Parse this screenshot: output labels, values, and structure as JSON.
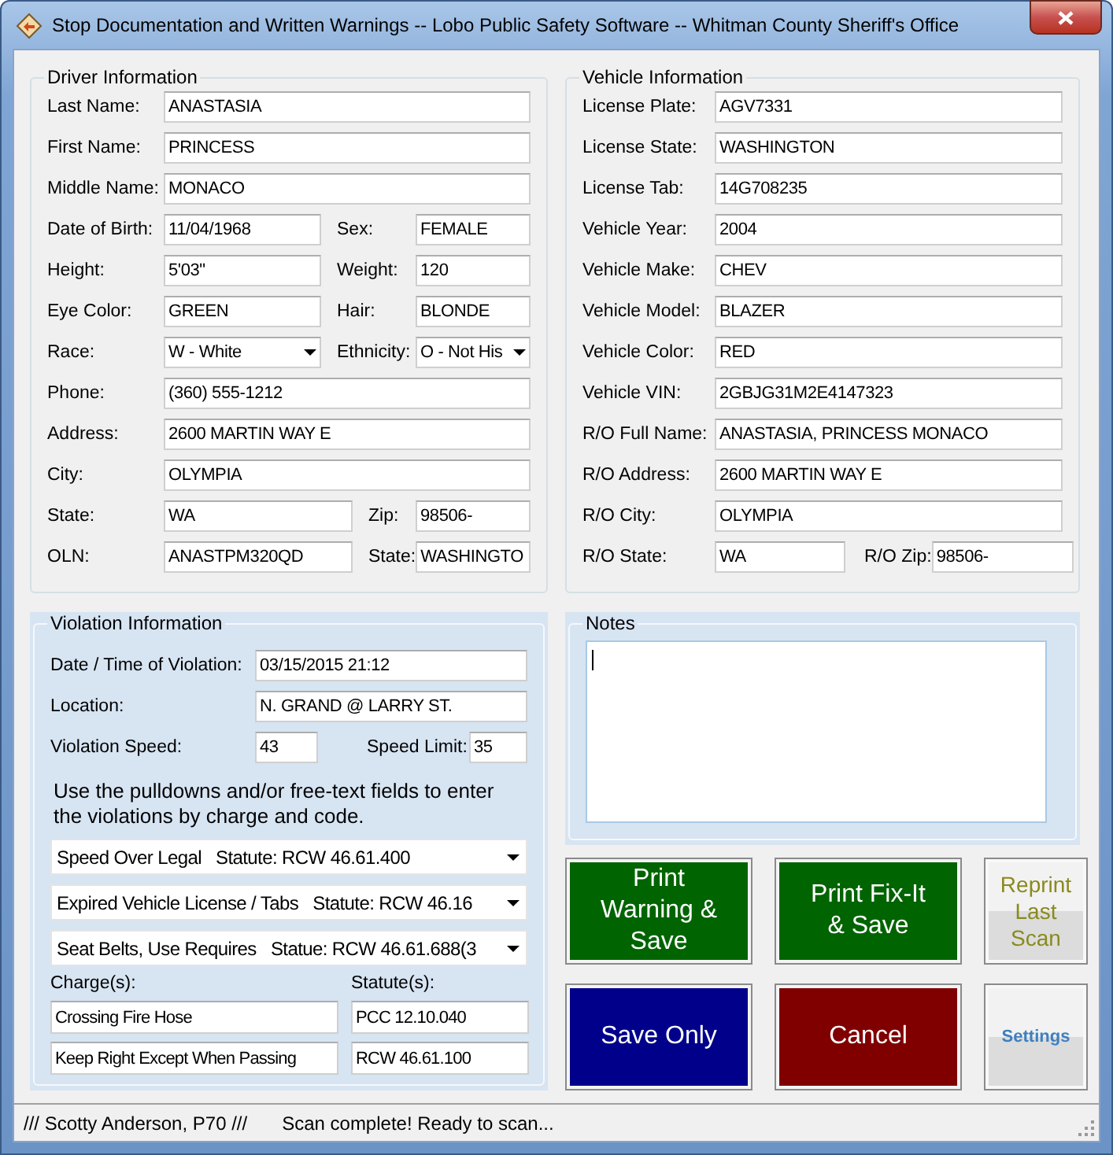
{
  "window": {
    "title": "Stop Documentation and Written Warnings -- Lobo Public Safety Software -- Whitman County Sheriff's Office"
  },
  "driver": {
    "title": "Driver Information",
    "rows": [
      {
        "kind": "single",
        "fields": [
          {
            "label": "Last Name:",
            "value": "ANASTASIA",
            "kind": "text"
          }
        ]
      },
      {
        "kind": "single",
        "fields": [
          {
            "label": "First Name:",
            "value": "PRINCESS",
            "kind": "text"
          }
        ]
      },
      {
        "kind": "single",
        "fields": [
          {
            "label": "Middle Name:",
            "value": "MONACO",
            "kind": "text"
          }
        ]
      },
      {
        "kind": "pair",
        "fields": [
          {
            "label": "Date of Birth:",
            "value": "11/04/1968",
            "kind": "text"
          },
          {
            "label": "Sex:",
            "value": "FEMALE",
            "kind": "text"
          }
        ]
      },
      {
        "kind": "pair",
        "fields": [
          {
            "label": "Height:",
            "value": "5'03\"",
            "kind": "text"
          },
          {
            "label": "Weight:",
            "value": "120",
            "kind": "text"
          }
        ]
      },
      {
        "kind": "pair",
        "fields": [
          {
            "label": "Eye Color:",
            "value": "GREEN",
            "kind": "text"
          },
          {
            "label": "Hair:",
            "value": "BLONDE",
            "kind": "text"
          }
        ]
      },
      {
        "kind": "pair",
        "fields": [
          {
            "label": "Race:",
            "value": "W - White",
            "kind": "dropdown"
          },
          {
            "label": "Ethnicity:",
            "value": "O - Not His",
            "kind": "dropdown"
          }
        ]
      },
      {
        "kind": "single",
        "fields": [
          {
            "label": "Phone:",
            "value": "(360) 555-1212",
            "kind": "text"
          }
        ]
      },
      {
        "kind": "single",
        "fields": [
          {
            "label": "Address:",
            "value": "2600 MARTIN WAY E",
            "kind": "text"
          }
        ]
      },
      {
        "kind": "single",
        "fields": [
          {
            "label": "City:",
            "value": "OLYMPIA",
            "kind": "text"
          }
        ]
      },
      {
        "kind": "pair_wide",
        "fields": [
          {
            "label": "State:",
            "value": "WA",
            "kind": "text"
          },
          {
            "label": "Zip:",
            "value": "98506-",
            "kind": "text"
          }
        ]
      },
      {
        "kind": "pair_wide",
        "fields": [
          {
            "label": "OLN:",
            "value": "ANASTPM320QD",
            "kind": "text"
          },
          {
            "label": "State:",
            "value": "WASHINGTO",
            "kind": "text"
          }
        ]
      }
    ]
  },
  "vehicle": {
    "title": "Vehicle Information",
    "rows": [
      {
        "kind": "single",
        "fields": [
          {
            "label": "License Plate:",
            "value": "AGV7331",
            "kind": "text"
          }
        ]
      },
      {
        "kind": "single",
        "fields": [
          {
            "label": "License State:",
            "value": "WASHINGTON",
            "kind": "text"
          }
        ]
      },
      {
        "kind": "single",
        "fields": [
          {
            "label": "License Tab:",
            "value": "14G708235",
            "kind": "text"
          }
        ]
      },
      {
        "kind": "single",
        "fields": [
          {
            "label": "Vehicle Year:",
            "value": "2004",
            "kind": "text"
          }
        ]
      },
      {
        "kind": "single",
        "fields": [
          {
            "label": "Vehicle Make:",
            "value": "CHEV",
            "kind": "text"
          }
        ]
      },
      {
        "kind": "single",
        "fields": [
          {
            "label": "Vehicle Model:",
            "value": "BLAZER",
            "kind": "text"
          }
        ]
      },
      {
        "kind": "single",
        "fields": [
          {
            "label": "Vehicle Color:",
            "value": "RED",
            "kind": "text"
          }
        ]
      },
      {
        "kind": "single",
        "fields": [
          {
            "label": "Vehicle VIN:",
            "value": "2GBJG31M2E4147323",
            "kind": "text"
          }
        ]
      },
      {
        "kind": "single",
        "fields": [
          {
            "label": "R/O Full Name:",
            "value": "ANASTASIA, PRINCESS MONACO",
            "kind": "text"
          }
        ]
      },
      {
        "kind": "single",
        "fields": [
          {
            "label": "R/O Address:",
            "value": "2600 MARTIN WAY E",
            "kind": "text"
          }
        ]
      },
      {
        "kind": "single",
        "fields": [
          {
            "label": "R/O City:",
            "value": "OLYMPIA",
            "kind": "text"
          }
        ]
      },
      {
        "kind": "pair",
        "fields": [
          {
            "label": "R/O State:",
            "value": "WA",
            "kind": "text"
          },
          {
            "label": "R/O Zip:",
            "value": "98506-",
            "kind": "text"
          }
        ]
      }
    ]
  },
  "violation": {
    "title": "Violation Information",
    "rows": [
      {
        "kind": "single",
        "fields": [
          {
            "label": "Date / Time of Violation:",
            "value": "03/15/2015 21:12",
            "kind": "text"
          }
        ]
      },
      {
        "kind": "single",
        "fields": [
          {
            "label": "Location:",
            "value": "N. GRAND @ LARRY ST.",
            "kind": "text"
          }
        ]
      },
      {
        "kind": "pair",
        "fields": [
          {
            "label": "Violation Speed:",
            "value": "43",
            "kind": "text"
          },
          {
            "label": "Speed Limit:",
            "value": "35",
            "kind": "text"
          }
        ]
      }
    ],
    "instructions": "Use the pulldowns and/or free-text fields to enter the violations by charge and code.",
    "violations": [
      "Speed Over Legal   Statute: RCW 46.61.400",
      "Expired Vehicle License / Tabs   Statute: RCW 46.16",
      "Seat Belts, Use Requires   Statue: RCW 46.61.688(3"
    ],
    "charge_header": "Charge(s):",
    "statute_header": "Statute(s):",
    "charges": [
      {
        "charge": "Crossing Fire Hose",
        "statute": "PCC 12.10.040"
      },
      {
        "charge": "Keep Right Except When Passing",
        "statute": "RCW 46.61.100"
      }
    ]
  },
  "notes": {
    "title": "Notes"
  },
  "buttons": [
    {
      "label": "Print Warning & Save",
      "kind": "filled",
      "color": "#006400"
    },
    {
      "label": "Print Fix-It & Save",
      "kind": "filled",
      "color": "#006400"
    },
    {
      "label": "Reprint Last Scan",
      "kind": "gray",
      "color": "#8a8a1e"
    },
    {
      "label": "Save Only",
      "kind": "filled",
      "color": "#00008b"
    },
    {
      "label": "Cancel",
      "kind": "filled",
      "color": "#800000"
    },
    {
      "label": "Settings",
      "kind": "small",
      "color": "#3f7fbf"
    }
  ],
  "status_bar": {
    "user": "/// Scotty Anderson, P70 ///",
    "message": "Scan complete!  Ready to scan..."
  }
}
